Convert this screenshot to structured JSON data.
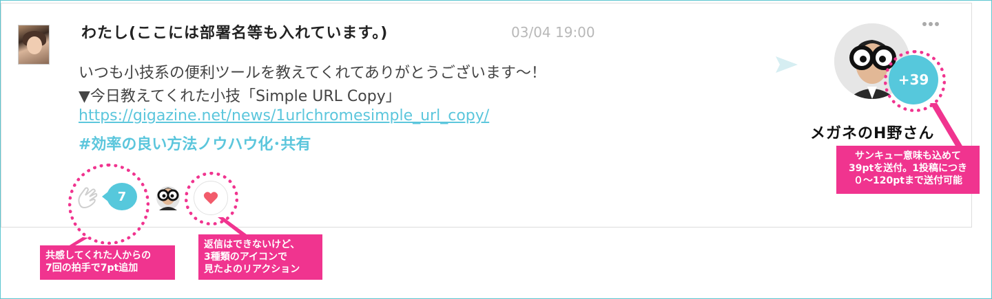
{
  "post": {
    "author": "わたし(ここには部署名等も入れています。)",
    "timestamp": "03/04 19:00",
    "lines": [
      "いつも小技系の便利ツールを教えてくれてありがとうございます～！",
      "▼今日教えてくれた小技「Simple URL Copy」"
    ],
    "link": "https://gigazine.net/news/1urlchromesimple_url_copy/",
    "hashtag": "#効率の良い方法ノウハウ化･共有"
  },
  "recipient": {
    "name": "メガネのH野さん",
    "points": "+39"
  },
  "reactions": {
    "clap_count": "7"
  },
  "annotations": {
    "clap": [
      "共感してくれた人からの",
      "7回の拍手で7pt追加"
    ],
    "reaction": [
      "返信はできないけど、",
      "3種類のアイコンで",
      "見たよのリアクション"
    ],
    "points": [
      "サンキュー意味も込めて",
      "39ptを送付。1投稿につき",
      "０～120ptまで送付可能"
    ]
  },
  "colors": {
    "accent": "#56c8dc",
    "callout": "#f0348f",
    "heart": "#f25b6b"
  },
  "icons": [
    "send-icon",
    "more-icon",
    "clap-icon",
    "heart-icon"
  ]
}
